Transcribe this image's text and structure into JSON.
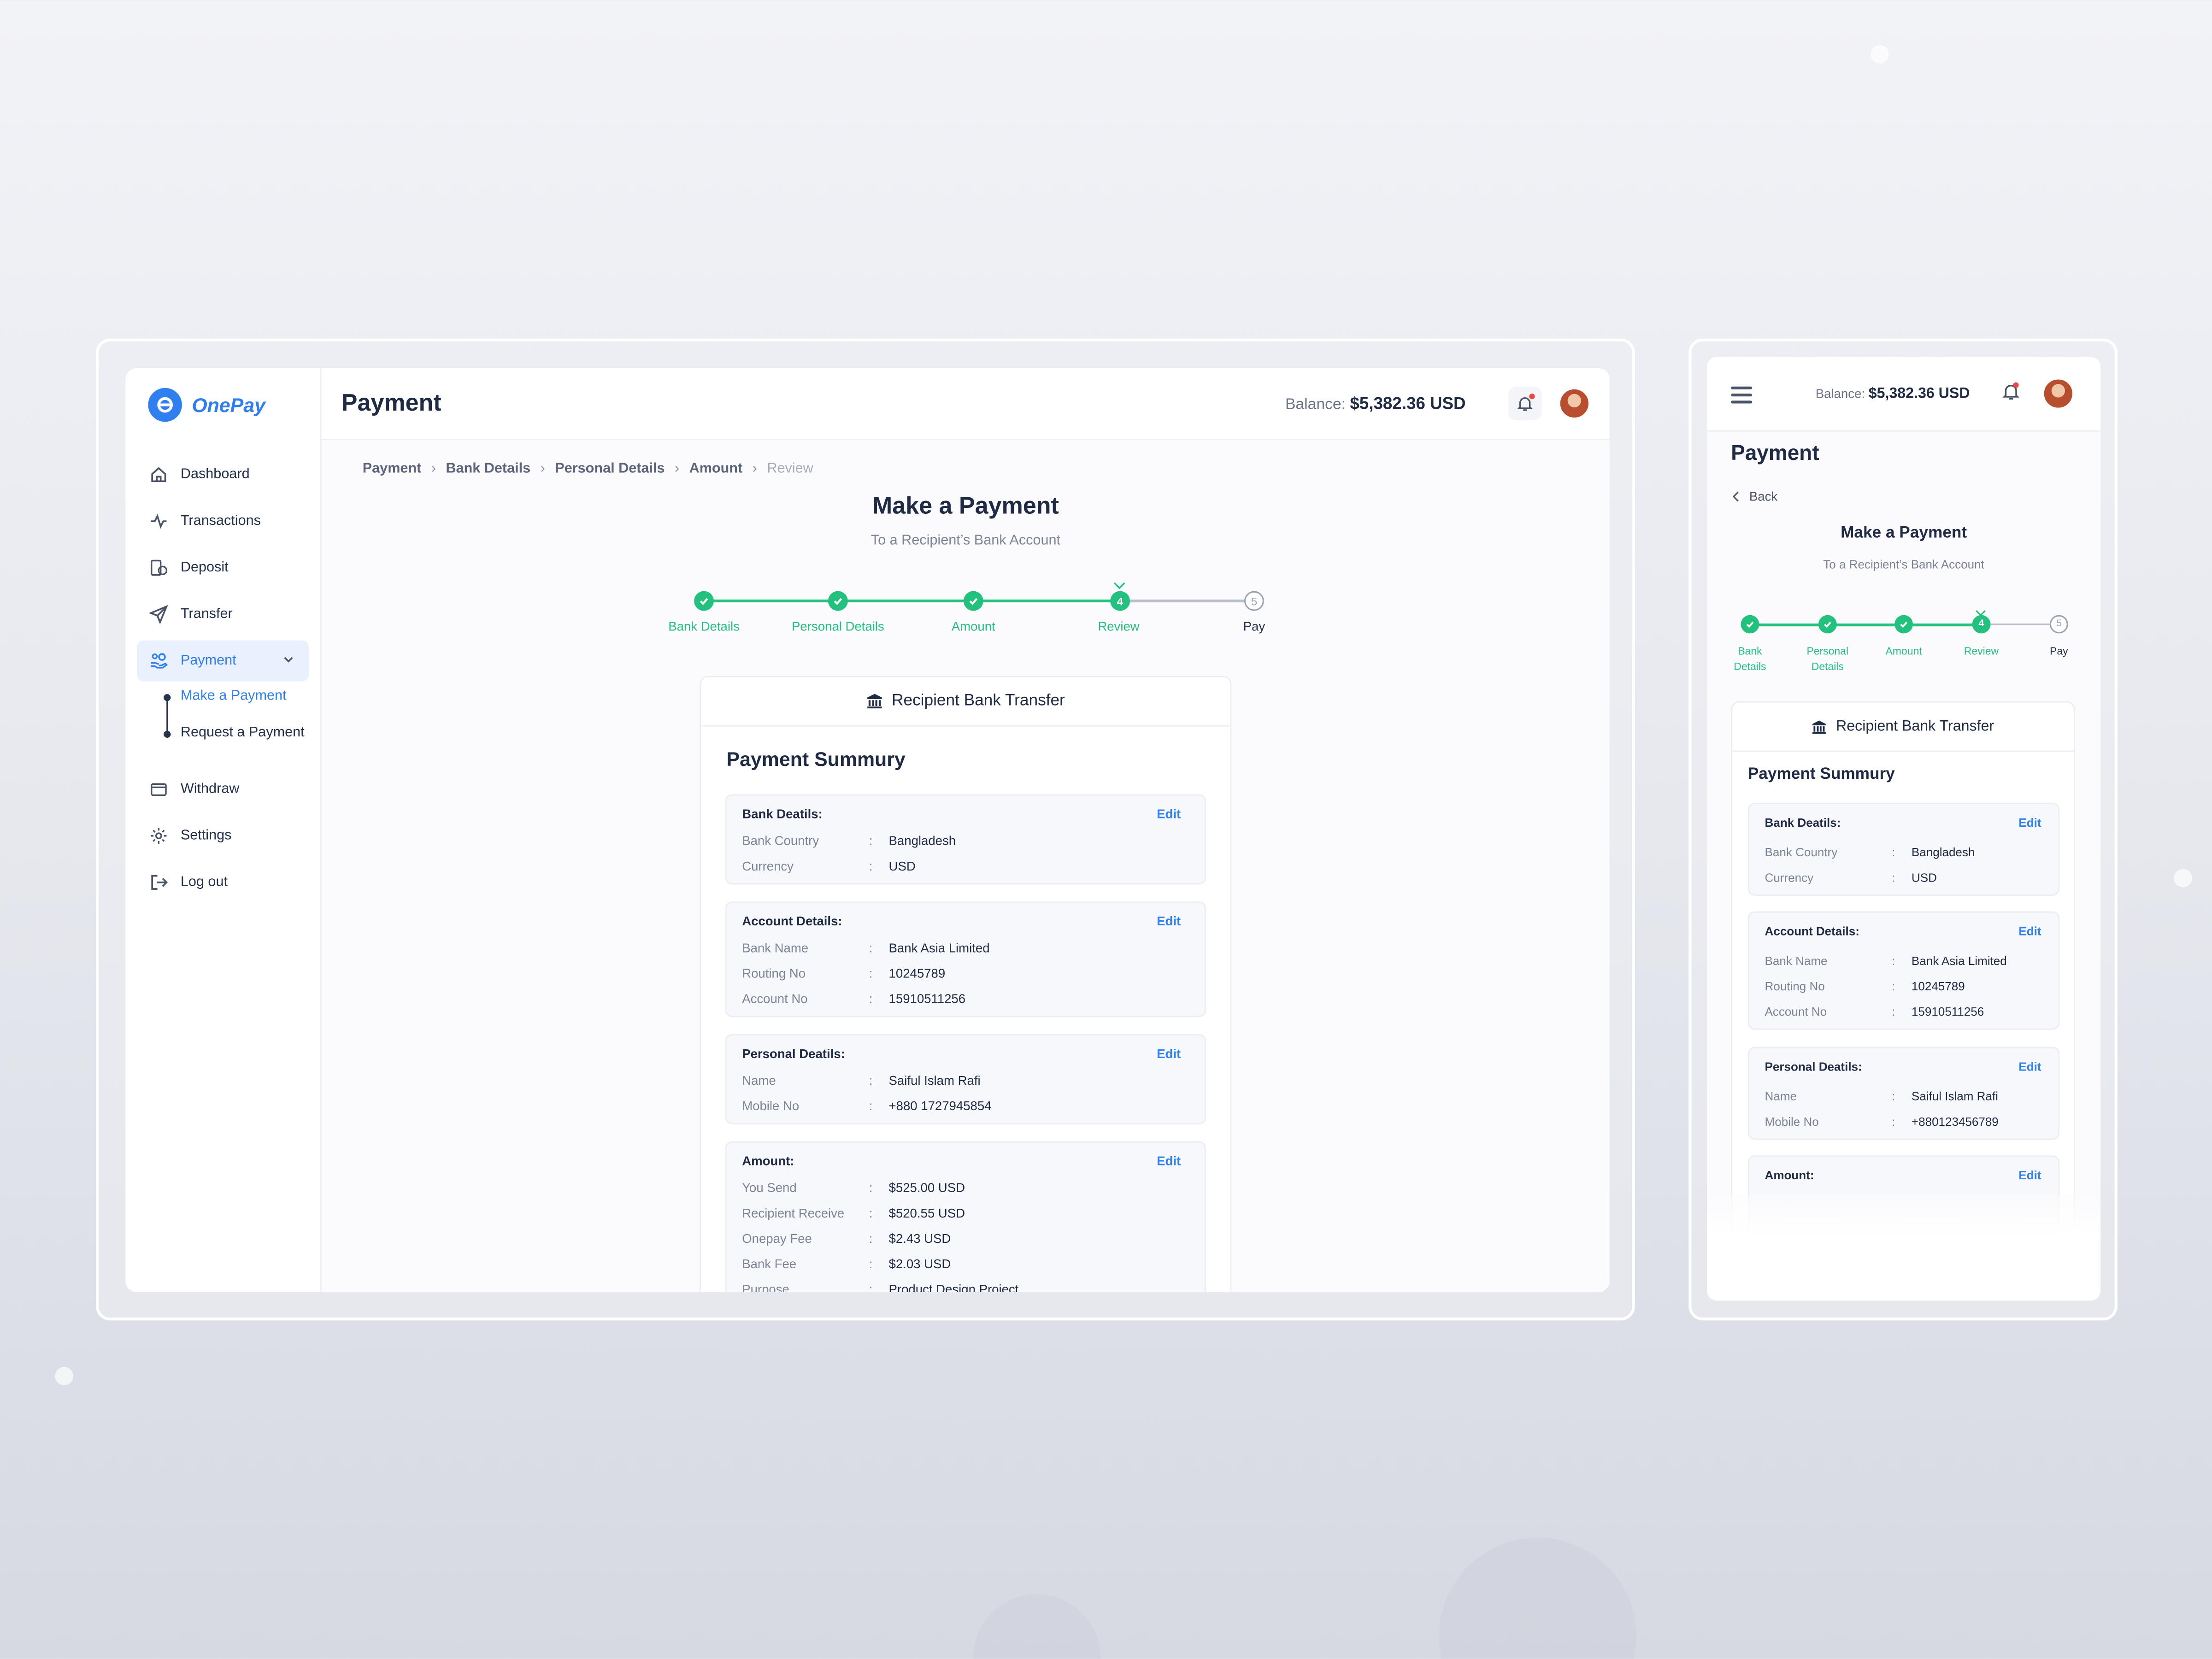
{
  "brand": {
    "name": "OnePay",
    "accent": "#2f7ff0",
    "success": "#22c17d"
  },
  "sidebar": {
    "items": [
      {
        "label": "Dashboard",
        "icon": "home-icon"
      },
      {
        "label": "Transactions",
        "icon": "activity-icon"
      },
      {
        "label": "Deposit",
        "icon": "coins-icon"
      },
      {
        "label": "Transfer",
        "icon": "send-icon"
      },
      {
        "label": "Payment",
        "icon": "hand-coins-icon",
        "active": true
      },
      {
        "label": "Withdraw",
        "icon": "wallet-icon"
      },
      {
        "label": "Settings",
        "icon": "gear-icon"
      },
      {
        "label": "Log out",
        "icon": "logout-icon"
      }
    ],
    "payment_sub": [
      "Make a Payment",
      "Request a Payment"
    ]
  },
  "header": {
    "title": "Payment",
    "balance_label": "Balance:",
    "balance_value": "$5,382.36 USD"
  },
  "breadcrumb": [
    "Payment",
    "Bank Details",
    "Personal Details",
    "Amount",
    "Review"
  ],
  "page": {
    "heading": "Make a Payment",
    "subheading": "To a Recipient’s Bank Account",
    "current_step": 4
  },
  "steps": [
    {
      "label": "Bank Details",
      "mobile_label_1": "Bank",
      "mobile_label_2": "Details",
      "status": "done"
    },
    {
      "label": "Personal Details",
      "mobile_label_1": "Personal",
      "mobile_label_2": "Details",
      "status": "done"
    },
    {
      "label": "Amount",
      "mobile_label_1": "Amount",
      "mobile_label_2": "",
      "status": "done"
    },
    {
      "label": "Review",
      "mobile_label_1": "Review",
      "mobile_label_2": "",
      "number": "4",
      "status": "current"
    },
    {
      "label": "Pay",
      "mobile_label_1": "Pay",
      "mobile_label_2": "",
      "number": "5",
      "status": "pending"
    }
  ],
  "card": {
    "header": "Recipient Bank Transfer",
    "summary_title": "Payment Summury",
    "edit_label": "Edit",
    "sections": {
      "bank": {
        "title": "Bank Deatils:",
        "rows": [
          {
            "k": "Bank Country",
            "v": "Bangladesh"
          },
          {
            "k": "Currency",
            "v": "USD"
          }
        ]
      },
      "account": {
        "title": "Account Details:",
        "rows": [
          {
            "k": "Bank Name",
            "v": "Bank Asia Limited"
          },
          {
            "k": "Routing No",
            "v": "10245789"
          },
          {
            "k": "Account No",
            "v": "15910511256"
          }
        ]
      },
      "personal": {
        "title": "Personal Deatils:",
        "rows": [
          {
            "k": "Name",
            "v": "Saiful Islam Rafi"
          },
          {
            "k": "Mobile No",
            "v": "+880 1727945854"
          }
        ]
      },
      "amount": {
        "title": "Amount:",
        "rows": [
          {
            "k": "You Send",
            "v": "$525.00 USD"
          },
          {
            "k": "Recipient Receive",
            "v": "$520.55 USD"
          },
          {
            "k": "Onepay Fee",
            "v": "$2.43 USD"
          },
          {
            "k": "Bank Fee",
            "v": "$2.03 USD"
          },
          {
            "k": "Purpose",
            "v": "Product Design Project"
          }
        ]
      }
    },
    "colon": ":"
  },
  "mobile": {
    "balance_label": "Balance:",
    "balance_value": "$5,382.36 USD",
    "title": "Payment",
    "back": "Back",
    "heading": "Make a Payment",
    "subheading": "To a Recipient’s Bank Account",
    "personal_mobile": "+880123456789"
  }
}
